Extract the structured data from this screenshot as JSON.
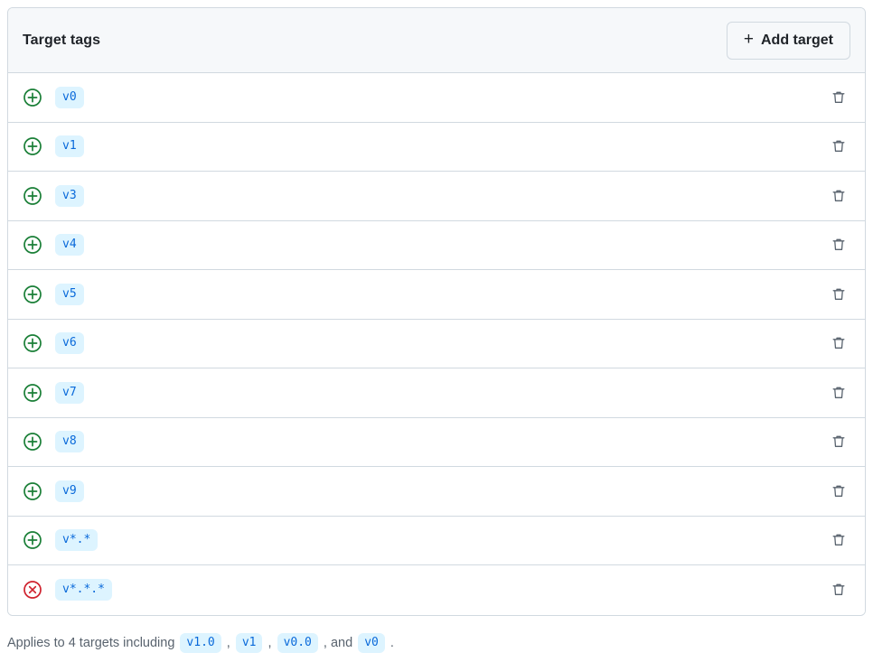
{
  "card": {
    "title": "Target tags",
    "add_button": {
      "label": "Add target",
      "icon": "plus-icon",
      "plus_glyph": "+"
    },
    "rows": [
      {
        "icon": "circled-plus-icon",
        "icon_state": "include",
        "tag": "v0",
        "delete_icon": "trash-icon"
      },
      {
        "icon": "circled-plus-icon",
        "icon_state": "include",
        "tag": "v1",
        "delete_icon": "trash-icon"
      },
      {
        "icon": "circled-plus-icon",
        "icon_state": "include",
        "tag": "v3",
        "delete_icon": "trash-icon"
      },
      {
        "icon": "circled-plus-icon",
        "icon_state": "include",
        "tag": "v4",
        "delete_icon": "trash-icon"
      },
      {
        "icon": "circled-plus-icon",
        "icon_state": "include",
        "tag": "v5",
        "delete_icon": "trash-icon"
      },
      {
        "icon": "circled-plus-icon",
        "icon_state": "include",
        "tag": "v6",
        "delete_icon": "trash-icon"
      },
      {
        "icon": "circled-plus-icon",
        "icon_state": "include",
        "tag": "v7",
        "delete_icon": "trash-icon"
      },
      {
        "icon": "circled-plus-icon",
        "icon_state": "include",
        "tag": "v8",
        "delete_icon": "trash-icon"
      },
      {
        "icon": "circled-plus-icon",
        "icon_state": "include",
        "tag": "v9",
        "delete_icon": "trash-icon"
      },
      {
        "icon": "circled-plus-icon",
        "icon_state": "include",
        "tag": "v*.*",
        "delete_icon": "trash-icon"
      },
      {
        "icon": "circled-x-icon",
        "icon_state": "exclude",
        "tag": "v*.*.*",
        "delete_icon": "trash-icon"
      }
    ]
  },
  "footer": {
    "prefix": "Applies to 4 targets including ",
    "chips": [
      "v1.0",
      "v1",
      "v0.0",
      "v0"
    ],
    "sep1": " , ",
    "sep2": " , ",
    "sep3": " , and ",
    "suffix": " ."
  },
  "colors": {
    "include_green": "#1a7f37",
    "exclude_red": "#cf222e",
    "chip_bg": "#ddf4ff",
    "chip_text": "#0969da",
    "border": "#d1d9e0",
    "header_bg": "#f6f8fa",
    "muted_text": "#59636e"
  }
}
